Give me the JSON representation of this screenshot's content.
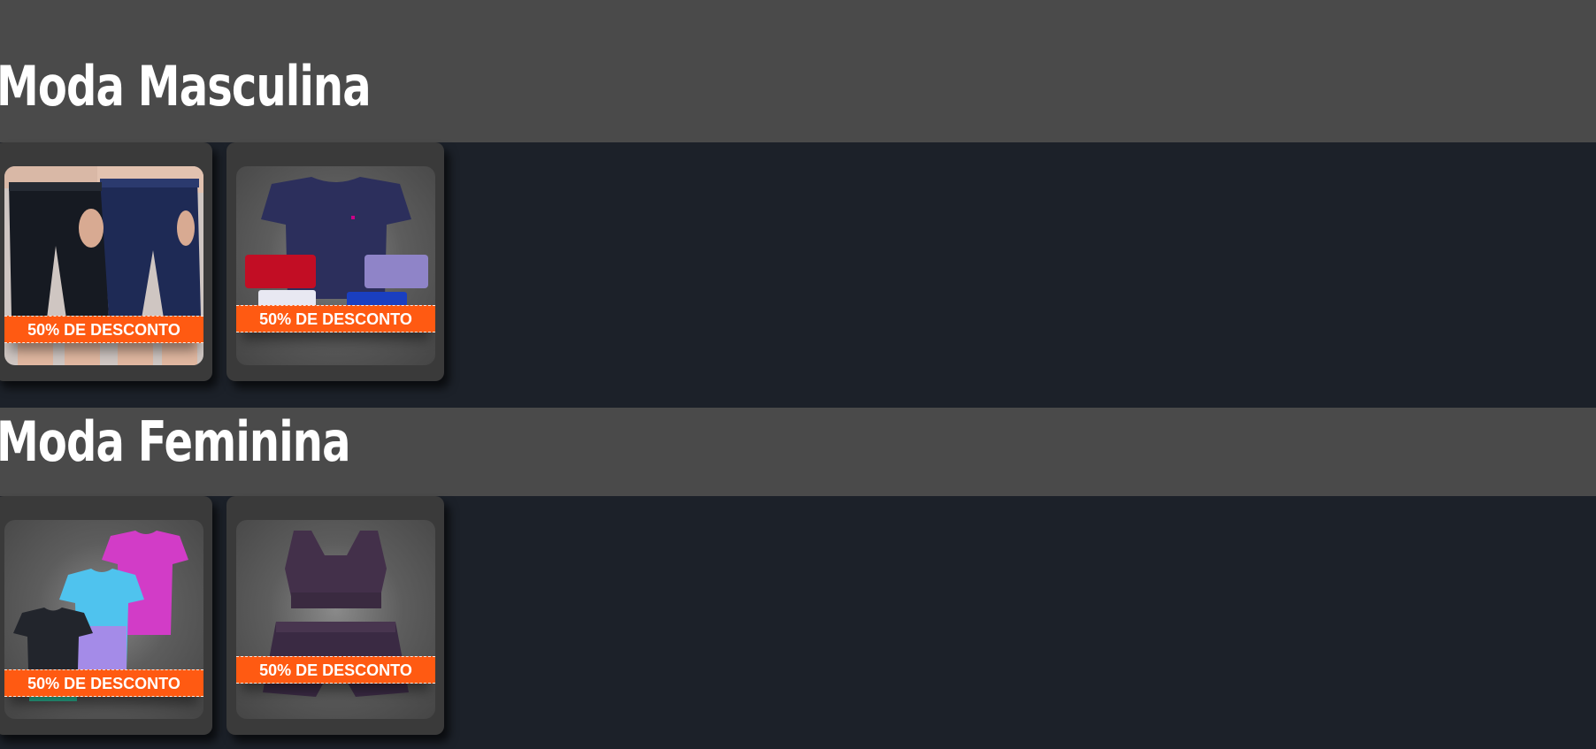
{
  "sections": [
    {
      "title": "Moda Masculina",
      "products": [
        {
          "badge": "50% DE DESCONTO",
          "image": "mens-shorts-photo"
        },
        {
          "badge": "50% DE DESCONTO",
          "image": "mens-tshirts-photo"
        }
      ]
    },
    {
      "title": "Moda Feminina",
      "products": [
        {
          "badge": "50% DE DESCONTO",
          "image": "womens-tshirts-photo"
        },
        {
          "badge": "50% DE DESCONTO",
          "image": "womens-top-and-shorts-photo"
        }
      ]
    }
  ],
  "colors": {
    "header_bg": "#4a4a4a",
    "page_bg": "#1c2129",
    "card_bg": "#3a3a3a",
    "badge_bg": "#ff5a12"
  }
}
